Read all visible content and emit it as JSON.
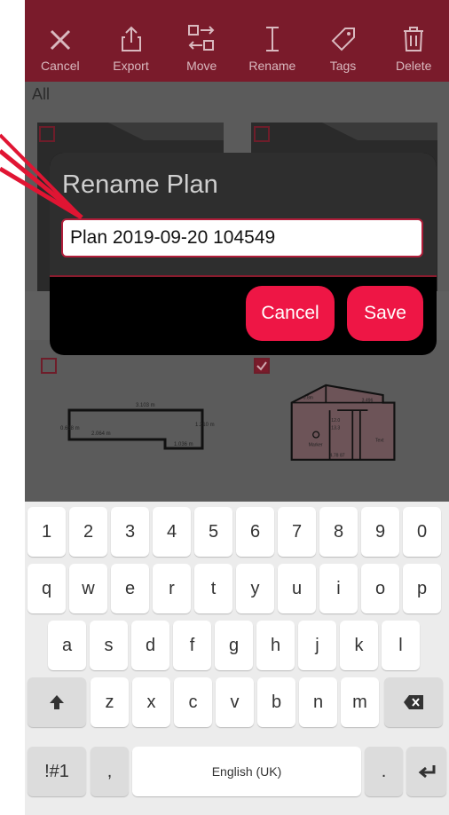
{
  "toolbar": {
    "items": [
      {
        "label": "Cancel",
        "icon": "close-icon"
      },
      {
        "label": "Export",
        "icon": "export-icon"
      },
      {
        "label": "Move",
        "icon": "move-icon"
      },
      {
        "label": "Rename",
        "icon": "text-cursor-icon"
      },
      {
        "label": "Tags",
        "icon": "tag-icon"
      },
      {
        "label": "Delete",
        "icon": "trash-icon"
      }
    ]
  },
  "content": {
    "filter_label": "All",
    "plan1": {
      "d1": "3.103 m",
      "d2": "2.064 m",
      "d3": "0.638 m",
      "d4": "1.210 m",
      "d5": "1.036 m"
    },
    "plan2": {
      "d1": "0.8m",
      "d2": "3.496",
      "d3": "12.0",
      "d4": "13.3",
      "marker": "Marker",
      "text": "Text",
      "d5": "4.78 87"
    }
  },
  "dialog": {
    "title": "Rename Plan",
    "input_value": "Plan 2019-09-20 104549",
    "cancel_label": "Cancel",
    "save_label": "Save"
  },
  "keyboard": {
    "row1": [
      "1",
      "2",
      "3",
      "4",
      "5",
      "6",
      "7",
      "8",
      "9",
      "0"
    ],
    "row2": [
      "q",
      "w",
      "e",
      "r",
      "t",
      "y",
      "u",
      "i",
      "o",
      "p"
    ],
    "row3": [
      "a",
      "s",
      "d",
      "f",
      "g",
      "h",
      "j",
      "k",
      "l"
    ],
    "row4": [
      "z",
      "x",
      "c",
      "v",
      "b",
      "n",
      "m"
    ],
    "symbols_label": "!#1",
    "comma": ",",
    "space_label": "English (UK)",
    "period": "."
  },
  "colors": {
    "accent": "#ee1645",
    "toolbar": "#7a1b2b"
  }
}
